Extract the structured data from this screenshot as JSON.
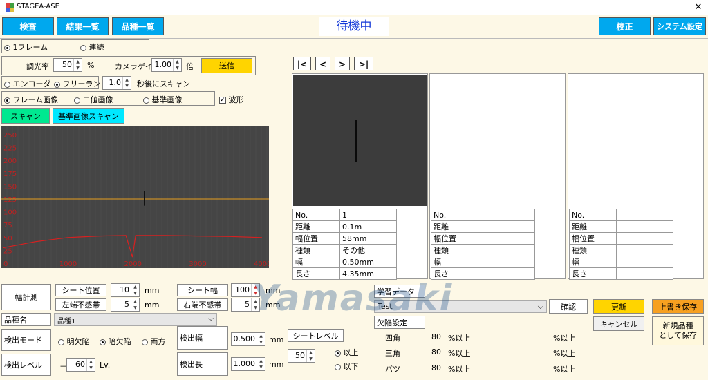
{
  "window": {
    "title": "STAGEA-ASE",
    "close_glyph": "✕"
  },
  "nav": {
    "inspect": "検査",
    "results": "結果一覧",
    "products": "品種一覧",
    "calibrate": "校正",
    "system": "システム設定"
  },
  "status": "待機中",
  "mode": {
    "frame1": "1フレーム",
    "continuous": "連続",
    "selected": "frame1"
  },
  "light": {
    "label": "調光率",
    "value": "50",
    "unit": "%",
    "gain_label": "カメラゲイン",
    "gain_value": "1.00",
    "gain_unit": "倍",
    "send": "送信"
  },
  "trigger": {
    "encoder": "エンコーダ",
    "freerun": "フリーラン",
    "selected": "freerun",
    "delay_value": "1.0",
    "delay_label": "秒後にスキャン"
  },
  "image_type": {
    "frame": "フレーム画像",
    "binary": "二値画像",
    "reference": "基準画像",
    "selected": "frame",
    "waveform": "波形",
    "waveform_checked": true
  },
  "scan": {
    "scan": "スキャン",
    "ref_scan": "基準画像スキャン"
  },
  "chart_data": {
    "type": "line",
    "y_ticks": [
      "250",
      "225",
      "200",
      "175",
      "150",
      "125",
      "100",
      "75",
      "50",
      "25",
      "0"
    ],
    "x_ticks": [
      "0",
      "1000",
      "2000",
      "3000",
      "4000"
    ],
    "xlim": [
      0,
      4000
    ],
    "ylim": [
      0,
      250
    ],
    "threshold": 125,
    "series": [
      {
        "x": [
          0,
          500,
          1000,
          1500,
          1900,
          2000,
          2050,
          2100,
          2500,
          3000,
          3500,
          4000
        ],
        "y": [
          30,
          42,
          50,
          53,
          54,
          12,
          54,
          54,
          54,
          53,
          52,
          50
        ]
      }
    ]
  },
  "pager": {
    "first": "|<",
    "prev": "<",
    "next": ">",
    "last": ">|"
  },
  "info_labels": [
    "No.",
    "距離",
    "幅位置",
    "種類",
    "幅",
    "長さ"
  ],
  "defects": [
    {
      "values": [
        "1",
        "0.1m",
        "58mm",
        "その他",
        "0.50mm",
        "4.35mm"
      ]
    },
    {
      "values": [
        "",
        "",
        "",
        "",
        "",
        ""
      ]
    },
    {
      "values": [
        "",
        "",
        "",
        "",
        "",
        ""
      ]
    }
  ],
  "measure": {
    "width_measure": "幅計測",
    "sheet_pos_label": "シート位置",
    "sheet_pos_value": "10",
    "sheet_pos_unit": "mm",
    "left_dead_label": "左端不感帯",
    "left_dead_value": "5",
    "left_dead_unit": "mm",
    "sheet_width_label": "シート幅",
    "sheet_width_value": "100",
    "sheet_width_unit": "mm",
    "right_dead_label": "右端不感帯",
    "right_dead_value": "5",
    "right_dead_unit": "mm"
  },
  "product": {
    "label": "品種名",
    "value": "品種1"
  },
  "detect": {
    "mode_label": "検出モード",
    "light_defect": "明欠陥",
    "dark_defect": "暗欠陥",
    "both": "両方",
    "selected": "dark",
    "level_label": "検出レベル",
    "level_minus": "－",
    "level_value": "60",
    "level_unit": "Lv.",
    "width_label": "検出幅",
    "width_value": "0.500",
    "width_unit": "mm",
    "length_label": "検出長",
    "length_value": "1.000",
    "length_unit": "mm",
    "sheet_level_label": "シートレベル",
    "sheet_level_value": "50",
    "above": "以上",
    "below": "以下",
    "level_sel": "above"
  },
  "learn": {
    "label": "学習データ",
    "value": "Test",
    "confirm": "確認",
    "defect_settings": "欠陥設定"
  },
  "defect_rows": [
    {
      "name": "四角",
      "value": "80",
      "unit": "%以上",
      "unit2": "%以上"
    },
    {
      "name": "三角",
      "value": "80",
      "unit": "%以上",
      "unit2": "%以上"
    },
    {
      "name": "バツ",
      "value": "80",
      "unit": "%以上",
      "unit2": "%以上"
    }
  ],
  "actions": {
    "update": "更新",
    "cancel": "キャンセル",
    "overwrite": "上書き保存",
    "save_new": "新規品種\nとして保存"
  },
  "watermark": "Yamasaki",
  "colors": {
    "nav": "#00a8ee",
    "send": "#ffd400",
    "scan": "#00e890",
    "refscan": "#00e8ff",
    "overwrite": "#f7a020",
    "grid_bg": "#454545",
    "threshold": "#e8a020",
    "wave": "#d82020"
  }
}
